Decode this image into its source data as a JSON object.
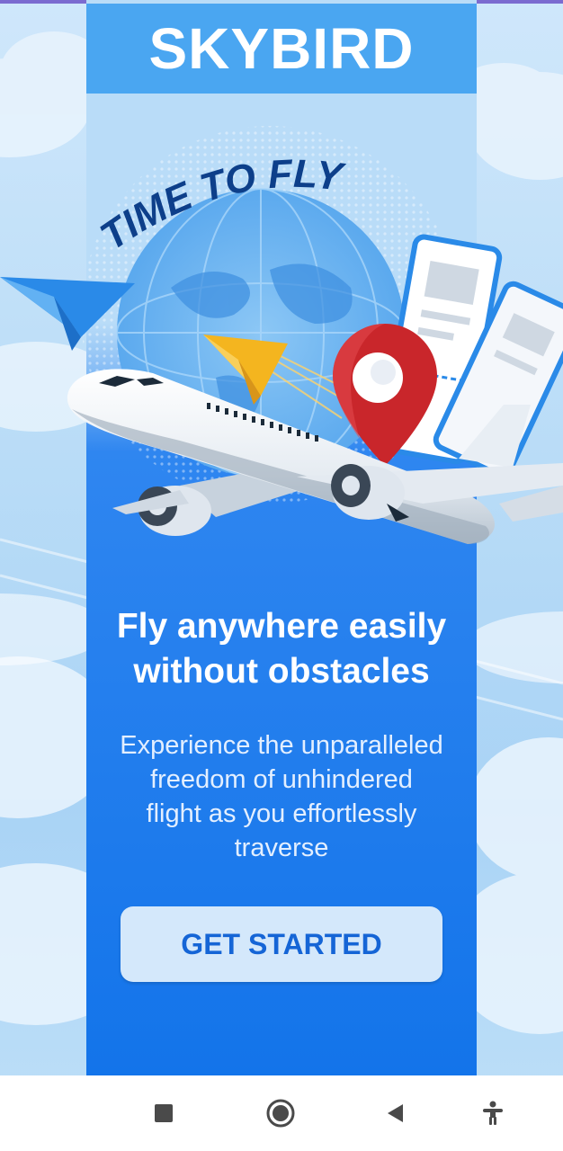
{
  "app": {
    "brand": "SKYBIRD"
  },
  "hero": {
    "illustration_caption": "TIME TO FLY",
    "headline_line1": "Fly anywhere easily",
    "headline_line2": "without obstacles",
    "subtext_line1": "Experience the unparalleled",
    "subtext_line2": "freedom of unhindered",
    "subtext_line3": "flight as you effortlessly",
    "subtext_line4": "traverse"
  },
  "cta": {
    "label": "GET STARTED"
  },
  "navbar": {
    "items": [
      "recent-apps",
      "home",
      "back",
      "accessibility"
    ]
  },
  "colors": {
    "panel": "#1374ea",
    "logo_bg": "#4aa6f1",
    "button_bg": "#d4e8fb",
    "button_text": "#1565d6",
    "pin": "#c9262b",
    "paper_plane_yellow": "#f4b51f"
  }
}
